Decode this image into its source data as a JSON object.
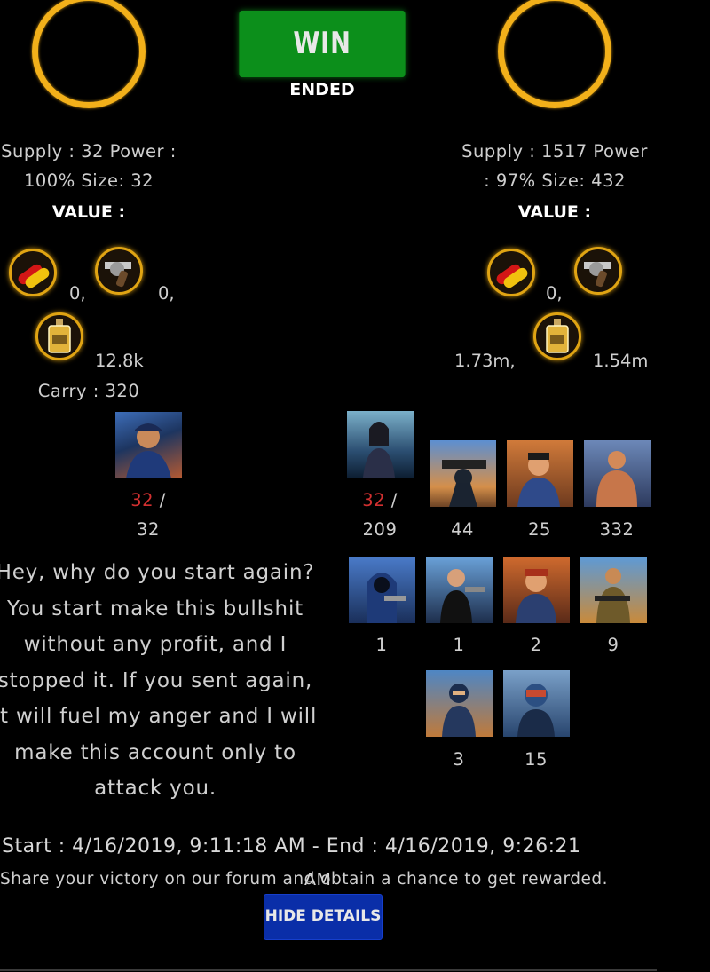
{
  "status": {
    "result": "WIN",
    "state": "ENDED"
  },
  "left": {
    "supply_line1": "Supply : 32 Power :",
    "supply_line2": "100% Size: 32",
    "value_label": "VALUE :",
    "drugs": "0,",
    "weapons": "0,",
    "alcohol": "12.8k",
    "carry": "Carry : 320",
    "units": [
      {
        "current": "32",
        "sep": " /",
        "total": "32"
      }
    ]
  },
  "right": {
    "supply_line1": "Supply : 1517 Power",
    "supply_line2": ": 97% Size: 432",
    "value_label": "VALUE :",
    "weapons": "0,",
    "drugs": "1.73m,",
    "alcohol": "1.54m",
    "units": [
      {
        "current": "32",
        "sep": " /",
        "total": "209"
      },
      {
        "total": "44"
      },
      {
        "total": "25"
      },
      {
        "total": "332"
      },
      {
        "total": "1"
      },
      {
        "total": "1"
      },
      {
        "total": "2"
      },
      {
        "total": "9"
      },
      {
        "total": "3"
      },
      {
        "total": "15"
      }
    ]
  },
  "message": "Hey, why do you start again? You start make this bullshit without any profit, and I stopped it. If you sent again, it will fuel my anger and I will make this account only to attack you.",
  "times": "Start : 4/16/2019, 9:11:18 AM - End : 4/16/2019, 9:26:21",
  "times_tail": "AM",
  "share": "Share your victory on our forum and obtain a chance to get rewarded.",
  "hide_button": "HIDE DETAILS",
  "icons": {
    "drugs": "pills-icon",
    "weapons": "revolver-icon",
    "alcohol": "bottle-icon"
  },
  "colors": {
    "win": "#0c8f1b",
    "ring": "#f2b01a",
    "hide": "#0a2ea8",
    "count_red": "#d23030"
  }
}
